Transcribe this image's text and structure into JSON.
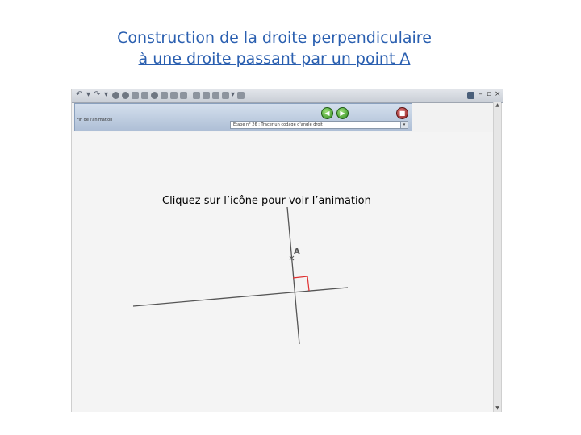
{
  "title": {
    "line1": "Construction de la droite perpendiculaire",
    "line2": "à une droite passant par un point A"
  },
  "window": {
    "controls": [
      "–",
      "▫",
      "×"
    ],
    "animation_bar": {
      "label": "Fin de l'animation",
      "step_select_value": "Etape n° 26 : Tracer un codage d'angle droit"
    }
  },
  "canvas": {
    "instruction": "Cliquez sur l’icône pour voir l’animation",
    "point_label": "A"
  },
  "colors": {
    "title": "#2a5fb0",
    "right_angle": "#e03030",
    "line": "#555555"
  }
}
